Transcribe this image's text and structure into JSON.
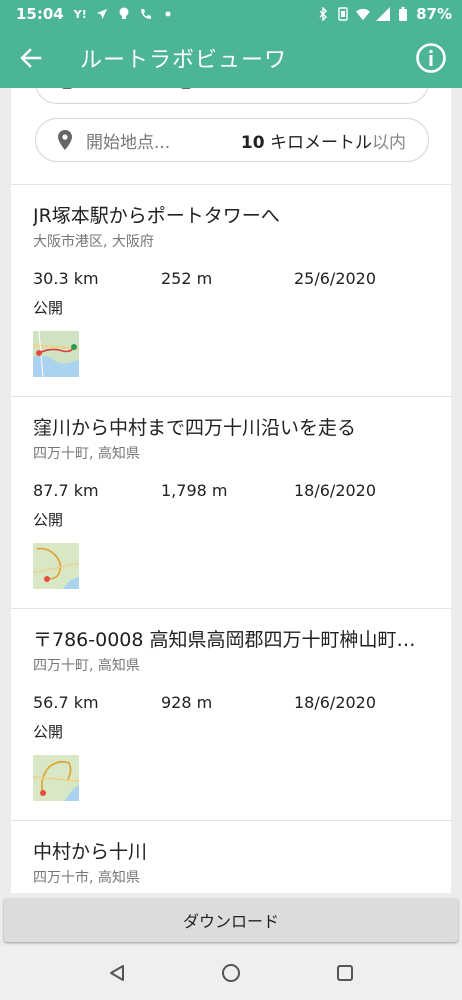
{
  "status_bar": {
    "time": "15:04",
    "battery": "87%",
    "left_icons": [
      "yahoo-icon",
      "navigation-icon",
      "bulb-icon",
      "phone-icon",
      "dot-icon"
    ],
    "right_icons": [
      "bluetooth-icon",
      "vibrate-icon",
      "wifi-icon",
      "signal-icon",
      "battery-icon"
    ]
  },
  "app_bar": {
    "title": "ルートラボビューワ"
  },
  "search": {
    "location_placeholder": "開始地点...",
    "radius_value": "10",
    "radius_unit": "キロメートル",
    "radius_suffix": "以内"
  },
  "routes": [
    {
      "title": "JR塚本駅からポートタワーへ",
      "location": "大阪市港区, 大阪府",
      "distance": "30.3 km",
      "elevation": "252 m",
      "date": "25/6/2020",
      "visibility": "公開"
    },
    {
      "title": "窪川から中村まで四万十川沿いを走る",
      "location": "四万十町, 高知県",
      "distance": "87.7 km",
      "elevation": "1,798 m",
      "date": "18/6/2020",
      "visibility": "公開"
    },
    {
      "title": "〒786-0008 高知県高岡郡四万十町榊山町…",
      "location": "四万十町, 高知県",
      "distance": "56.7 km",
      "elevation": "928 m",
      "date": "18/6/2020",
      "visibility": "公開"
    },
    {
      "title": "中村から十川",
      "location": "四万十市, 高知県"
    }
  ],
  "download": {
    "label": "ダウンロード"
  },
  "colors": {
    "primary": "#4db597",
    "background": "#ececec"
  }
}
